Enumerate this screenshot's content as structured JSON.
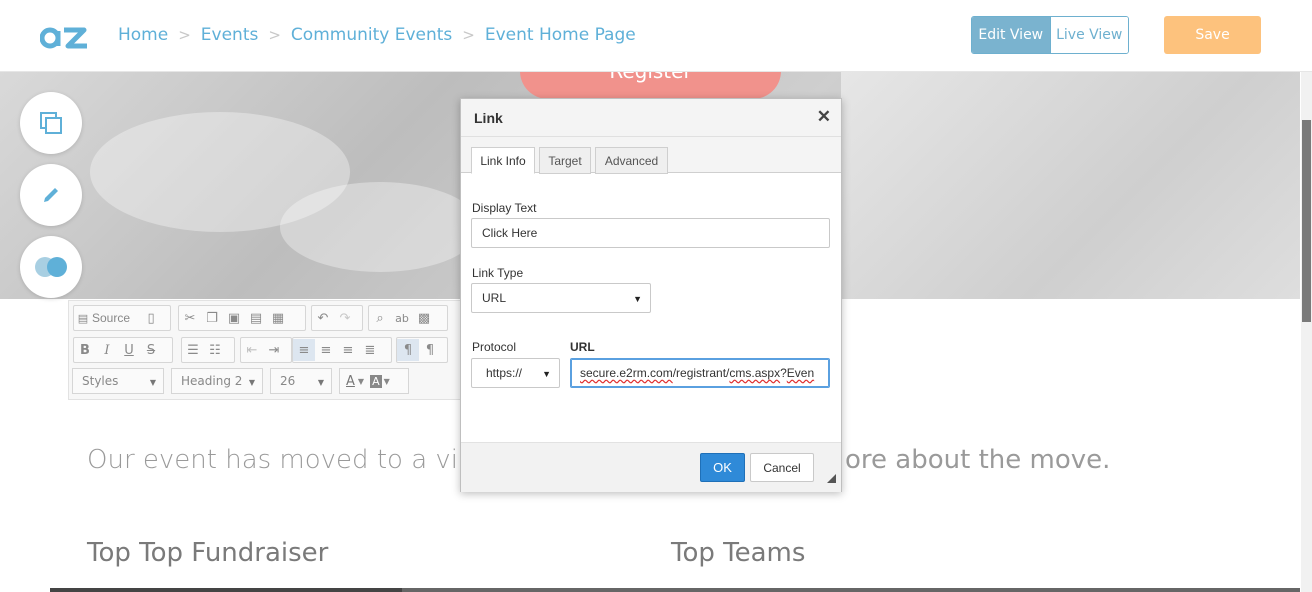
{
  "header": {
    "breadcrumbs": [
      "Home",
      "Events",
      "Community Events",
      "Event Home Page"
    ],
    "separator": ">",
    "edit_view": "Edit View",
    "live_view": "Live View",
    "save": "Save"
  },
  "hero": {
    "register_label": "Register"
  },
  "toolbar": {
    "source_label": "Source",
    "styles_label": "Styles",
    "format_label": "Heading 2",
    "size_label": "26",
    "bold": "B",
    "italic": "I",
    "underline": "U",
    "strike": "S"
  },
  "content": {
    "intro_left": "Our event has moved to a virtu",
    "intro_right": "ore about the move.",
    "heading_left": "Top Top Fundraiser",
    "heading_right": "Top Teams"
  },
  "dialog": {
    "title": "Link",
    "tabs": [
      "Link Info",
      "Target",
      "Advanced"
    ],
    "display_text_label": "Display Text",
    "display_text_value": "Click Here",
    "link_type_label": "Link Type",
    "link_type_value": "URL",
    "protocol_label": "Protocol",
    "protocol_value": "https://",
    "url_label": "URL",
    "url_part1": "secure.e2rm.com",
    "url_part2": "/registrant/",
    "url_part3": "cms.aspx",
    "url_part4": "?",
    "url_part5": "Even",
    "ok_label": "OK",
    "cancel_label": "Cancel"
  },
  "colors": {
    "accent": "#5fb0d8",
    "save": "#fdc27d",
    "register": "#f1928c",
    "ok": "#2f8ad8"
  }
}
